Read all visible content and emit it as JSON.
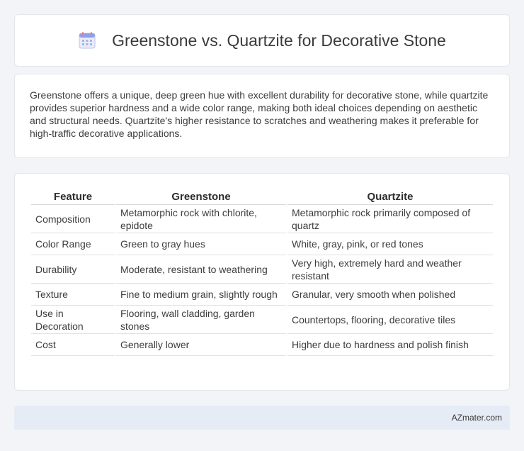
{
  "header": {
    "title": "Greenstone vs. Quartzite for Decorative Stone",
    "icon": "calendar-icon"
  },
  "summary": {
    "text": "Greenstone offers a unique, deep green hue with excellent durability for decorative stone, while quartzite provides superior hardness and a wide color range, making both ideal choices depending on aesthetic and structural needs. Quartzite's higher resistance to scratches and weathering makes it preferable for high-traffic decorative applications."
  },
  "table": {
    "headers": [
      "Feature",
      "Greenstone",
      "Quartzite"
    ],
    "rows": [
      [
        "Composition",
        "Metamorphic rock with chlorite, epidote",
        "Metamorphic rock primarily composed of quartz"
      ],
      [
        "Color Range",
        "Green to gray hues",
        "White, gray, pink, or red tones"
      ],
      [
        "Durability",
        "Moderate, resistant to weathering",
        "Very high, extremely hard and weather resistant"
      ],
      [
        "Texture",
        "Fine to medium grain, slightly rough",
        "Granular, very smooth when polished"
      ],
      [
        "Use in Decoration",
        "Flooring, wall cladding, garden stones",
        "Countertops, flooring, decorative tiles"
      ],
      [
        "Cost",
        "Generally lower",
        "Higher due to hardness and polish finish"
      ]
    ]
  },
  "footer": {
    "brand": "AZmater.com"
  }
}
